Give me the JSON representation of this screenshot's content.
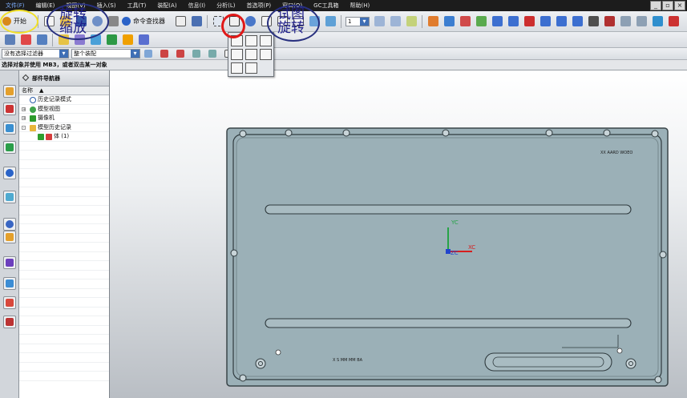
{
  "menubar": {
    "items": [
      "文件(F)",
      "编辑(E)",
      "视图(V)",
      "插入(S)",
      "工具(T)",
      "装配(A)",
      "信息(I)",
      "分析(L)",
      "首选项(P)",
      "窗口(O)",
      "GC工具箱",
      "帮助(H)"
    ]
  },
  "toolbar": {
    "start_label": "开始",
    "command_finder_label": "命令查找器",
    "layer_field_value": "1"
  },
  "filter_bar": {
    "selection_filter": "没有选择过滤器",
    "assembly_scope": "整个装配"
  },
  "prompt": {
    "text": "选择对象并使用 MB3，或者双击某一对象"
  },
  "navigator": {
    "title": "部件导航器",
    "column_name": "名称",
    "sort_glyph": "▲",
    "rows": [
      {
        "label": "历史记录模式",
        "icon": "clock-icon",
        "indent": 0,
        "expand": ""
      },
      {
        "label": "模型视图",
        "icon": "camera-icon",
        "indent": 0,
        "expand": "+"
      },
      {
        "label": "摄像机",
        "icon": "check-icon",
        "indent": 0,
        "expand": "+"
      },
      {
        "label": "模型历史记录",
        "icon": "folder-icon",
        "indent": 0,
        "expand": "-"
      },
      {
        "label": "体 (1)",
        "icon": "solid-body-icon",
        "indent": 1,
        "expand": ""
      }
    ]
  },
  "model": {
    "part_label": "XX AARD WOEO",
    "bottom_text": "X S MM MM BA",
    "axes": {
      "y": "YC",
      "x": "XC",
      "z": "ZC"
    }
  },
  "annotations": {
    "left_note": "旋转 缩放",
    "right_note": "试图 旋转"
  },
  "colors": {
    "annotation_yellow": "#f1e02a",
    "annotation_red": "#e01818",
    "annotation_blue": "#28307f",
    "part_fill": "#98aeb5",
    "part_edge": "#3a4549",
    "axis_x": "#d61f1f",
    "axis_y": "#27a347",
    "axis_z": "#2244cc"
  }
}
